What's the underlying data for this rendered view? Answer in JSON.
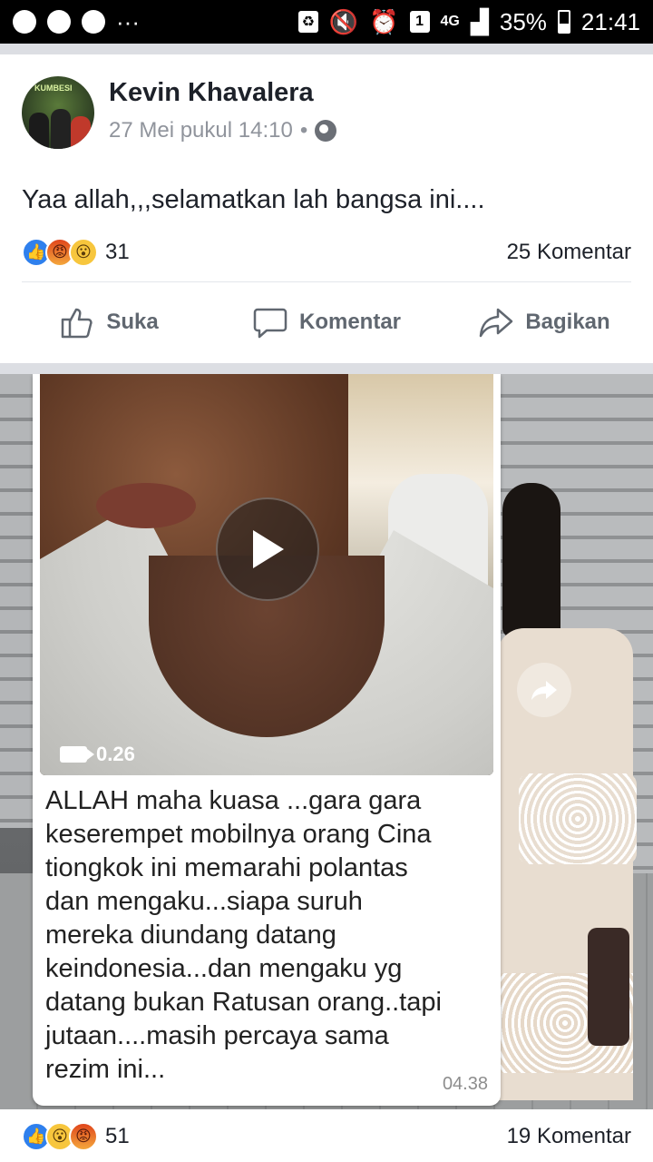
{
  "status_bar": {
    "net": "4G",
    "sim": "1",
    "battery": "35%",
    "time": "21:41",
    "left_dots": "···"
  },
  "post": {
    "author": "Kevin Khavalera",
    "timestamp": "27 Mei pukul 14:10",
    "separator": "•",
    "privacy_icon": "globe-icon",
    "text": "Yaa allah,,,selamatkan lah bangsa ini....",
    "reaction_count": "31",
    "comment_count": "25 Komentar",
    "actions": {
      "like": "Suka",
      "comment": "Komentar",
      "share": "Bagikan"
    }
  },
  "media": {
    "video_duration": "0.26",
    "caption_lines": [
      "ALLAH maha kuasa ...gara gara",
      "keserempet mobilnya orang Cina",
      "tiongkok ini memarahi polantas",
      "dan mengaku...siapa suruh",
      "mereka diundang datang",
      "keindonesia...dan mengaku yg",
      "datang bukan Ratusan orang..tapi",
      "jutaan....masih percaya sama",
      "rezim ini..."
    ],
    "message_time": "04.38"
  },
  "next_post": {
    "reaction_count": "51",
    "comment_count": "19 Komentar"
  },
  "colors": {
    "like_blue": "#2f80ed",
    "text": "#1d2129",
    "muted": "#606770"
  }
}
